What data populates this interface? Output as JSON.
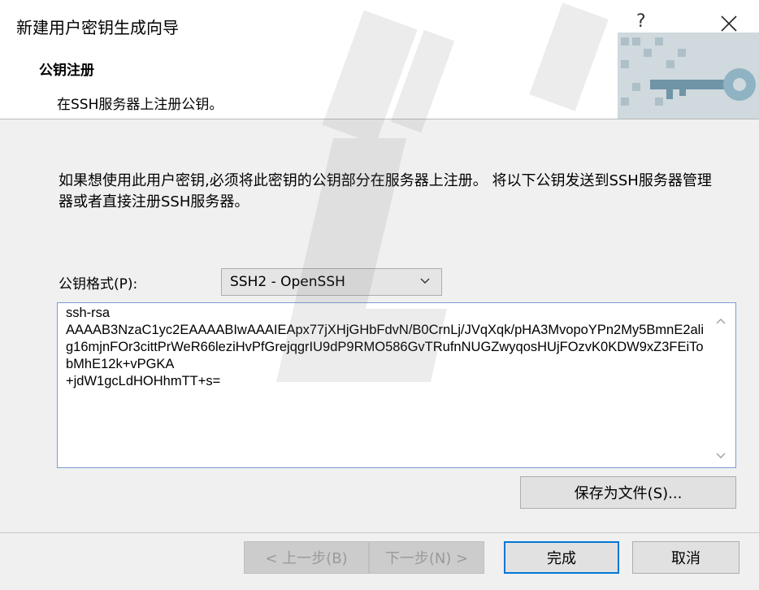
{
  "window": {
    "title": "新建用户密钥生成向导",
    "help": "?"
  },
  "header": {
    "title": "公钥注册",
    "subtitle": "在SSH服务器上注册公钥。"
  },
  "description": "如果想使用此用户密钥,必须将此密钥的公钥部分在服务器上注册。 将以下公钥发送到SSH服务器管理器或者直接注册SSH服务器。",
  "format": {
    "label": "公钥格式(P):",
    "selected": "SSH2 - OpenSSH"
  },
  "public_key": "ssh-rsa\nAAAAB3NzaC1yc2EAAAABIwAAAIEApx77jXHjGHbFdvN/B0CrnLj/JVqXqk/pHA3MvopoYPn2My5BmnE2alig16mjnFOr3cittPrWeR66leziHvPfGrejqgrIU9dP9RMO586GvTRufnNUGZwyqosHUjFOzvK0KDW9xZ3FEiTobMhE12k+vPGKA\n+jdW1gcLdHOHhmTT+s=",
  "buttons": {
    "save": "保存为文件(S)...",
    "back": "< 上一步(B)",
    "next": "下一步(N) >",
    "finish": "完成",
    "cancel": "取消"
  },
  "colors": {
    "focus": "#0078d7",
    "field_border": "#7a9cd3"
  }
}
